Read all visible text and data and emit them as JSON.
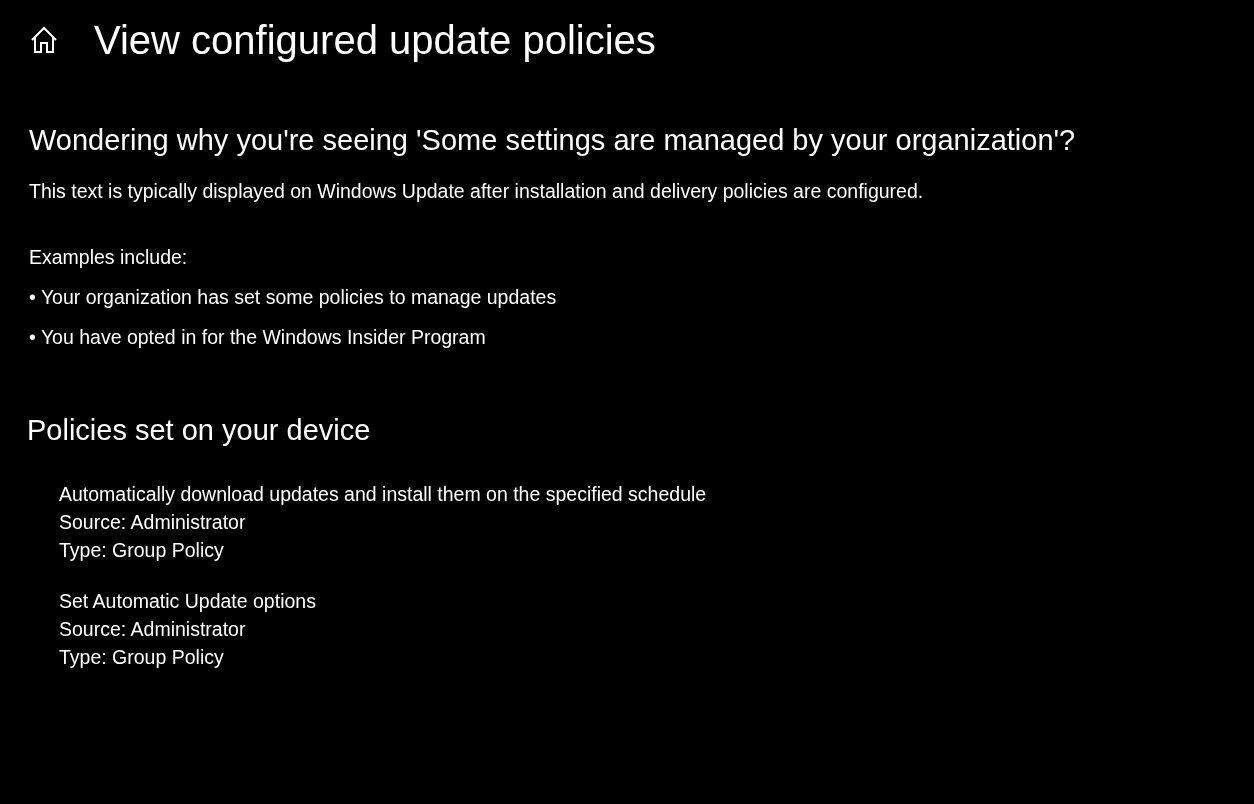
{
  "header": {
    "title": "View configured update policies"
  },
  "info": {
    "heading": "Wondering why you're seeing 'Some settings are managed by your organization'?",
    "description": "This text is typically displayed on Windows Update after installation and delivery policies are configured.",
    "examples_label": "Examples include:",
    "examples": [
      "• Your organization has set some policies to manage updates",
      "• You have opted in for the Windows Insider Program"
    ]
  },
  "policies": {
    "heading": "Policies set on your device",
    "items": [
      {
        "name": "Automatically download updates and install them on the specified schedule",
        "source": "Source: Administrator",
        "type": "Type: Group Policy"
      },
      {
        "name": "Set Automatic Update options",
        "source": "Source: Administrator",
        "type": "Type: Group Policy"
      }
    ]
  }
}
